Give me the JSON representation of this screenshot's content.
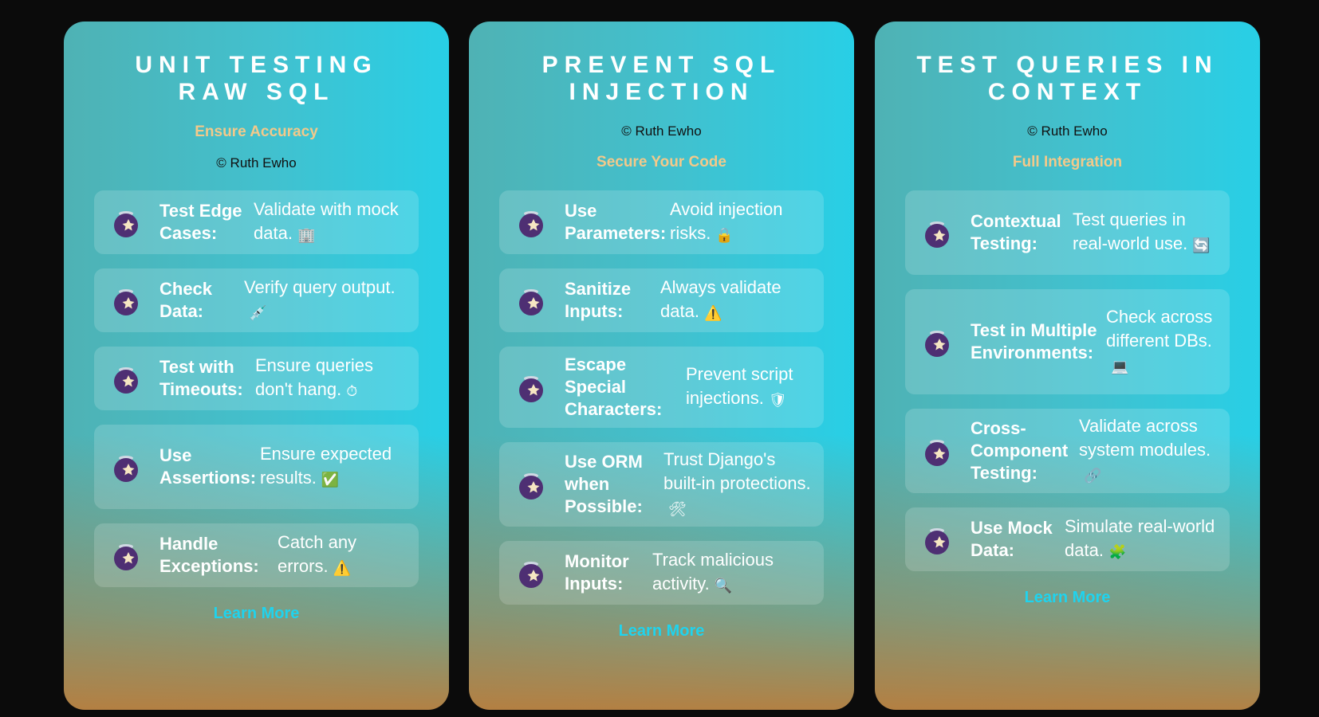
{
  "cards": [
    {
      "title": "Unit Testing Raw SQL",
      "subtitle": "Ensure Accuracy",
      "copyright": "© Ruth Ewho",
      "items": [
        {
          "label": "Test Edge Cases:",
          "desc": "Validate with mock data.",
          "emoji": "🏢"
        },
        {
          "label": "Check Data:",
          "desc": "Verify query output.",
          "emoji": "💉"
        },
        {
          "label": "Test with Timeouts:",
          "desc": "Ensure queries don't hang.",
          "emoji": "⏱"
        },
        {
          "label": "Use Assertions:",
          "desc": "Ensure expected results.",
          "emoji": "✅"
        },
        {
          "label": "Handle Exceptions:",
          "desc": "Catch any errors.",
          "emoji": "⚠️"
        }
      ],
      "link": "Learn More"
    },
    {
      "title": "Prevent SQL Injection",
      "subtitle": "Secure Your Code",
      "copyright": "© Ruth Ewho",
      "items": [
        {
          "label": "Use Parameters:",
          "desc": "Avoid injection risks.",
          "emoji": "🔒"
        },
        {
          "label": "Sanitize Inputs:",
          "desc": "Always validate data.",
          "emoji": "⚠️"
        },
        {
          "label": "Escape Special Characters:",
          "desc": "Prevent script injections.",
          "emoji": "🛡"
        },
        {
          "label": "Use ORM when Possible:",
          "desc": "Trust Django's built-in protections.",
          "emoji": "🛠"
        },
        {
          "label": "Monitor Inputs:",
          "desc": "Track malicious activity.",
          "emoji": "🔍"
        }
      ],
      "link": "Learn More"
    },
    {
      "title": "Test Queries in Context",
      "subtitle": "Full Integration",
      "copyright": "© Ruth Ewho",
      "items": [
        {
          "label": "Contextual Testing:",
          "desc": "Test queries in real-world use.",
          "emoji": "🔄"
        },
        {
          "label": "Test in Multiple Environments:",
          "desc": "Check across different DBs.",
          "emoji": "💻"
        },
        {
          "label": "Cross-Component Testing:",
          "desc": "Validate across system modules.",
          "emoji": "🔗"
        },
        {
          "label": "Use Mock Data:",
          "desc": "Simulate real-world data.",
          "emoji": "🧩"
        }
      ],
      "link": "Learn More"
    }
  ]
}
